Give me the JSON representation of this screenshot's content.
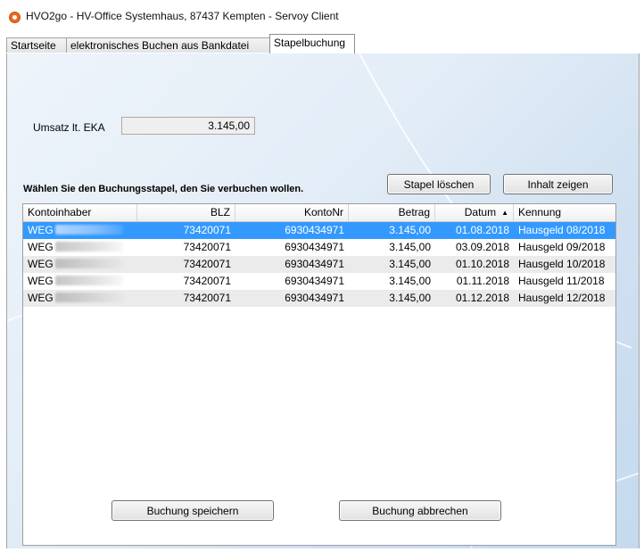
{
  "window": {
    "title": "HVO2go - HV-Office Systemhaus, 87437 Kempten  - Servoy Client"
  },
  "tabs": [
    {
      "label": "Startseite"
    },
    {
      "label": "elektronisches Buchen aus Bankdatei"
    },
    {
      "label": "Stapelbuchung"
    }
  ],
  "umsatz": {
    "label": "Umsatz lt. EKA",
    "value": "3.145,00"
  },
  "instruction": "Wählen Sie den Buchungsstapel, den Sie verbuchen wollen.",
  "buttons": {
    "stapel_loeschen": "Stapel löschen",
    "inhalt_zeigen": "Inhalt zeigen",
    "buchung_speichern": "Buchung speichern",
    "buchung_abbrechen": "Buchung abbrechen"
  },
  "table": {
    "columns": [
      "Kontoinhaber",
      "BLZ",
      "KontoNr",
      "Betrag",
      "Datum",
      "Kennung"
    ],
    "sort_indicator": "▲",
    "rows": [
      {
        "kontoinhaber": "WEG",
        "blz": "73420071",
        "kontonr": "6930434971",
        "betrag": "3.145,00",
        "datum": "01.08.2018",
        "kennung": "Hausgeld 08/2018"
      },
      {
        "kontoinhaber": "WEG",
        "blz": "73420071",
        "kontonr": "6930434971",
        "betrag": "3.145,00",
        "datum": "03.09.2018",
        "kennung": "Hausgeld 09/2018"
      },
      {
        "kontoinhaber": "WEG",
        "blz": "73420071",
        "kontonr": "6930434971",
        "betrag": "3.145,00",
        "datum": "01.10.2018",
        "kennung": "Hausgeld 10/2018"
      },
      {
        "kontoinhaber": "WEG",
        "blz": "73420071",
        "kontonr": "6930434971",
        "betrag": "3.145,00",
        "datum": "01.11.2018",
        "kennung": "Hausgeld 11/2018"
      },
      {
        "kontoinhaber": "WEG",
        "blz": "73420071",
        "kontonr": "6930434971",
        "betrag": "3.145,00",
        "datum": "01.12.2018",
        "kennung": "Hausgeld 12/2018"
      }
    ]
  },
  "colors": {
    "selection": "#3399ff",
    "app_icon": "#e86a1e"
  }
}
